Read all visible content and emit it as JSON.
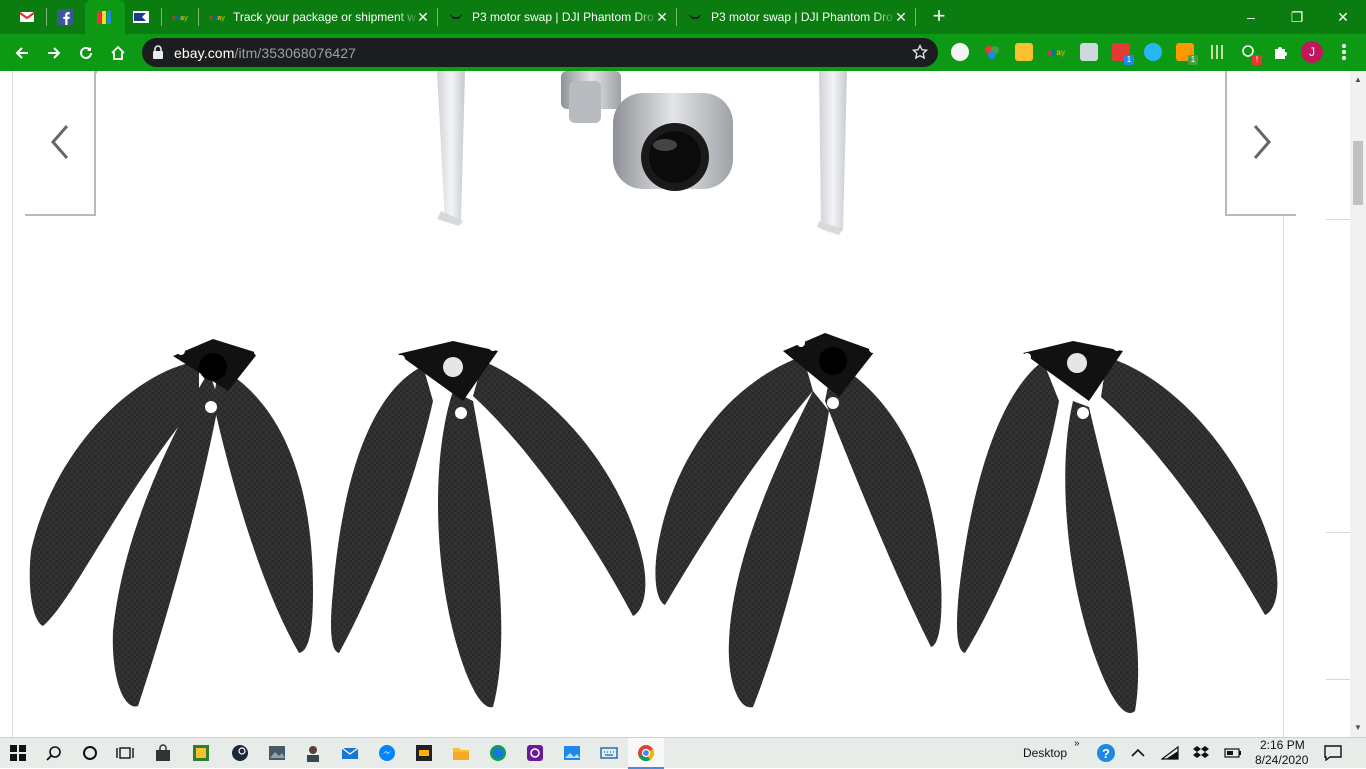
{
  "browser": {
    "tabs": [
      {
        "id": "gmail",
        "title": "",
        "icon": "gmail-icon"
      },
      {
        "id": "facebook",
        "title": "",
        "icon": "facebook-icon"
      },
      {
        "id": "pinned3",
        "title": "",
        "icon": "colorful-bars-icon",
        "active": true
      },
      {
        "id": "pinned4",
        "title": "",
        "icon": "flag-icon"
      },
      {
        "id": "pinned5",
        "title": "",
        "icon": "ebay-icon"
      },
      {
        "id": "track",
        "title": "Track your package or shipment w",
        "icon": "ebay-icon"
      },
      {
        "id": "p3a",
        "title": "P3 motor swap | DJI Phantom Dro",
        "icon": "drone-icon"
      },
      {
        "id": "p3b",
        "title": "P3 motor swap | DJI Phantom Dro",
        "icon": "drone-icon"
      }
    ],
    "new_tab": "+",
    "window_controls": {
      "minimize": "–",
      "maximize": "❐",
      "close": "✕"
    },
    "url": {
      "host": "ebay.com",
      "path": "/itm/353068076427"
    },
    "profile_initial": "J",
    "theme": {
      "tabstrip": "#0a7c10",
      "toolbar": "#0d9914",
      "omnibox": "#1b1d1f"
    }
  },
  "gallery": {
    "prev_icon": "chevron-left-icon",
    "next_icon": "chevron-right-icon"
  },
  "taskbar": {
    "desktop_label": "Desktop",
    "chevron": "»",
    "time": "2:16 PM",
    "date": "8/24/2020"
  }
}
